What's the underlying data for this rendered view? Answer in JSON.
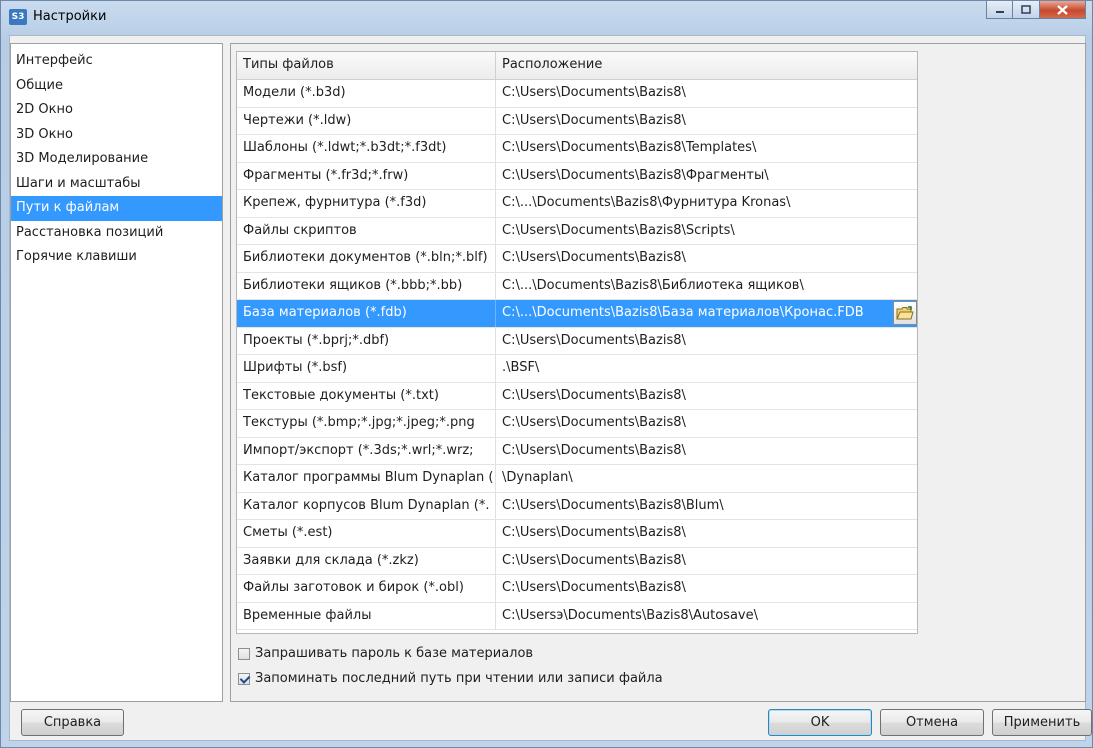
{
  "window": {
    "title": "Настройки",
    "app_icon": "S3"
  },
  "sidebar": {
    "items": [
      "Интерфейс",
      "Общие",
      "2D Окно",
      "3D Окно",
      "3D Моделирование",
      "Шаги и масштабы",
      "Пути к файлам",
      "Расстановка позиций",
      "Горячие клавиши"
    ],
    "active_index": 6
  },
  "table": {
    "headers": [
      "Типы файлов",
      "Расположение"
    ],
    "rows": [
      [
        "Модели (*.b3d)",
        "C:\\Users\\Documents\\Bazis8\\"
      ],
      [
        "Чертежи (*.ldw)",
        "C:\\Users\\Documents\\Bazis8\\"
      ],
      [
        "Шаблоны (*.ldwt;*.b3dt;*.f3dt)",
        "C:\\Users\\Documents\\Bazis8\\Templates\\"
      ],
      [
        "Фрагменты (*.fr3d;*.frw)",
        "C:\\Users\\Documents\\Bazis8\\Фрагменты\\"
      ],
      [
        "Крепеж, фурнитура (*.f3d)",
        "C:\\...\\Documents\\Bazis8\\Фурнитура Kronas\\"
      ],
      [
        "Файлы скриптов",
        "C:\\Users\\Documents\\Bazis8\\Scripts\\"
      ],
      [
        "Библиотеки документов (*.bln;*.blf)",
        "C:\\Users\\Documents\\Bazis8\\"
      ],
      [
        "Библиотеки ящиков (*.bbb;*.bb)",
        "C:\\...\\Documents\\Bazis8\\Библиотека ящиков\\"
      ],
      [
        "База материалов (*.fdb)",
        "C:\\...\\Documents\\Bazis8\\База материалов\\Кронас.FDB"
      ],
      [
        "Проекты (*.bprj;*.dbf)",
        "C:\\Users\\Documents\\Bazis8\\"
      ],
      [
        "Шрифты (*.bsf)",
        ".\\BSF\\"
      ],
      [
        "Текстовые документы (*.txt)",
        "C:\\Users\\Documents\\Bazis8\\"
      ],
      [
        "Текстуры (*.bmp;*.jpg;*.jpeg;*.png",
        "C:\\Users\\Documents\\Bazis8\\"
      ],
      [
        "Импорт/экспорт (*.3ds;*.wrl;*.wrz;",
        "C:\\Users\\Documents\\Bazis8\\"
      ],
      [
        "Каталог программы Blum Dynaplan (",
        "\\Dynaplan\\"
      ],
      [
        "Каталог корпусов Blum Dynaplan (*.",
        "C:\\Users\\Documents\\Bazis8\\Blum\\"
      ],
      [
        "Сметы (*.est)",
        "C:\\Users\\Documents\\Bazis8\\"
      ],
      [
        "Заявки для склада (*.zkz)",
        "C:\\Users\\Documents\\Bazis8\\"
      ],
      [
        "Файлы заготовок и бирок (*.obl)",
        "C:\\Users\\Documents\\Bazis8\\"
      ],
      [
        "Временные файлы",
        "C:\\Usersэ\\Documents\\Bazis8\\Autosave\\"
      ]
    ],
    "selected_index": 8,
    "browse_icon": "open-folder-icon"
  },
  "options": [
    {
      "label": "Запрашивать пароль к базе материалов",
      "checked": false
    },
    {
      "label": "Запоминать последний путь при чтении или записи файла",
      "checked": true
    }
  ],
  "buttons": {
    "help": "Справка",
    "ok": "OK",
    "cancel": "Отмена",
    "apply": "Применить"
  },
  "colors": {
    "selection": "#3399ff",
    "close_button": "#c8492c"
  }
}
